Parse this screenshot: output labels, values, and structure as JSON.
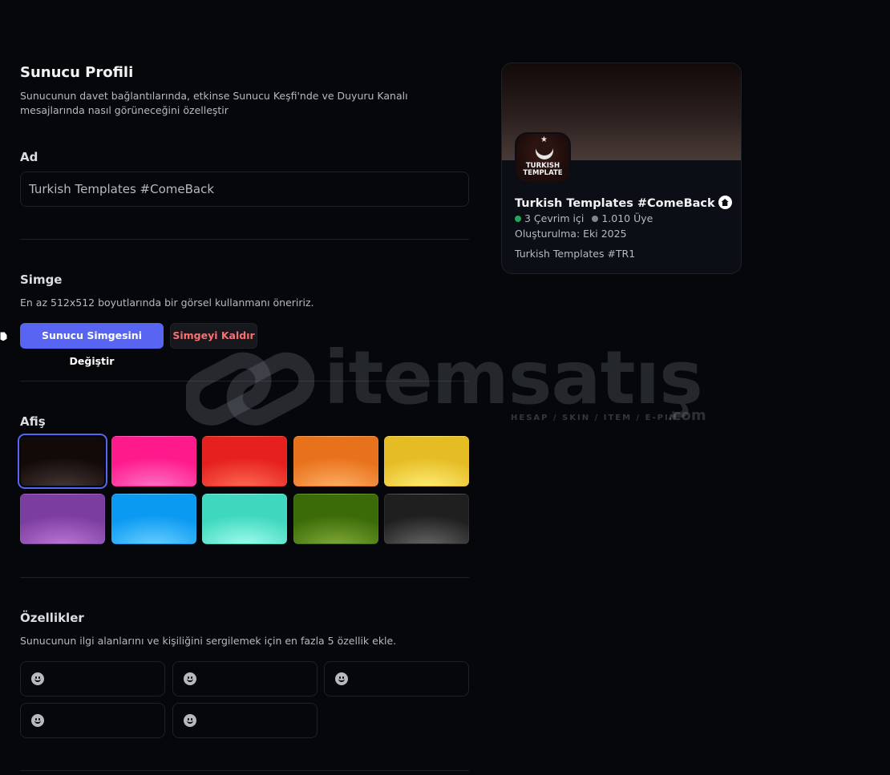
{
  "page": {
    "title": "Sunucu Profili",
    "description": "Sunucunun davet bağlantılarında, etkinse Sunucu Keşfi'nde ve Duyuru Kanalı mesajlarında nasıl görüneceğini özelleştir"
  },
  "name_section": {
    "label": "Ad",
    "value": "Turkish Templates #ComeBack"
  },
  "icon_section": {
    "label": "Simge",
    "help": "En az 512x512 boyutlarında bir görsel kullanmanı öneririz.",
    "change_button": "Sunucu Simgesini Değiştir",
    "remove_button": "Simgeyi Kaldır"
  },
  "banner_section": {
    "label": "Afiş",
    "colors": [
      {
        "name": "dark-brown",
        "top": "#120a09",
        "bottom": "#4a3b37",
        "selected": true
      },
      {
        "name": "pink",
        "top": "#ff1a8c",
        "bottom": "#ff7ac8",
        "selected": false
      },
      {
        "name": "red",
        "top": "#e5201f",
        "bottom": "#ff7055",
        "selected": false
      },
      {
        "name": "orange",
        "top": "#e8721c",
        "bottom": "#ffb36b",
        "selected": false
      },
      {
        "name": "yellow",
        "top": "#e6bc25",
        "bottom": "#fff27a",
        "selected": false
      },
      {
        "name": "purple",
        "top": "#7b3ea0",
        "bottom": "#c27ad8",
        "selected": false
      },
      {
        "name": "blue",
        "top": "#0b9af2",
        "bottom": "#6fd3ff",
        "selected": false
      },
      {
        "name": "teal",
        "top": "#3fd8bf",
        "bottom": "#a8fff0",
        "selected": false
      },
      {
        "name": "green",
        "top": "#3b6b08",
        "bottom": "#86ad3c",
        "selected": false
      },
      {
        "name": "gray",
        "top": "#1f1f1f",
        "bottom": "#6a6a6a",
        "selected": false
      }
    ]
  },
  "traits_section": {
    "label": "Özellikler",
    "help": "Sunucunun ilgi alanlarını ve kişiliğini sergilemek için en fazla 5 özellik ekle.",
    "slots": [
      {
        "icon": "emoji-icon"
      },
      {
        "icon": "emoji-icon"
      },
      {
        "icon": "emoji-icon"
      },
      {
        "icon": "emoji-icon"
      },
      {
        "icon": "emoji-icon"
      }
    ]
  },
  "preview": {
    "icon_text_line1": "TURKISH",
    "icon_text_line2": "TEMPLATE",
    "server_name": "Turkish Templates #ComeBack",
    "online": "3 Çevrim içi",
    "members": "1.010 Üye",
    "created": "Oluşturulma: Eki 2025",
    "description": "Turkish Templates #TR1",
    "online_color": "#23a55a",
    "members_color": "#80848e"
  },
  "watermark": {
    "brand": "itemsatış",
    "tagline": "HESAP / SKIN / ITEM / E-PIN",
    "suffix": ".com"
  }
}
